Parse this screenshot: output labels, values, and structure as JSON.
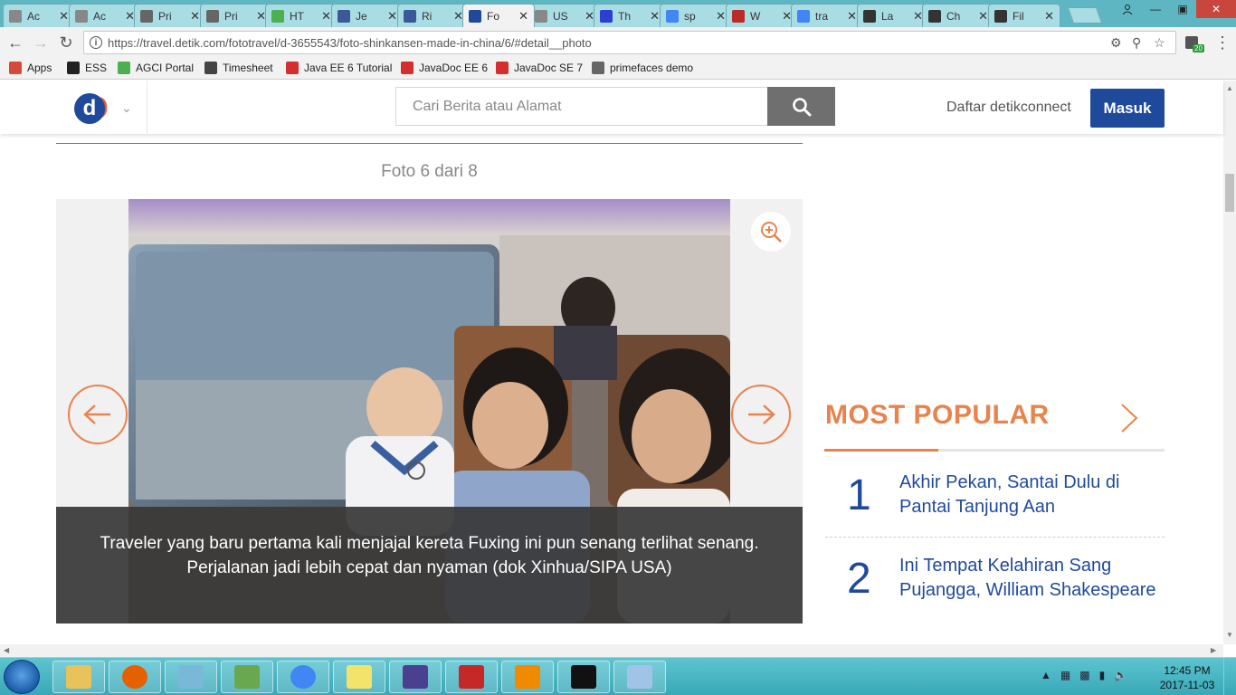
{
  "browser": {
    "tabs": [
      {
        "title": "Ac",
        "icon": "page-icon",
        "color": "#888888"
      },
      {
        "title": "Ac",
        "icon": "page-icon",
        "color": "#888888"
      },
      {
        "title": "Pri",
        "icon": "shield-icon",
        "color": "#666666"
      },
      {
        "title": "Pri",
        "icon": "shield-icon",
        "color": "#666666"
      },
      {
        "title": "HT",
        "icon": "html-icon",
        "color": "#4caf50"
      },
      {
        "title": "Je",
        "icon": "facebook-icon",
        "color": "#3b5998"
      },
      {
        "title": "Ri",
        "icon": "facebook-icon",
        "color": "#3b5998"
      },
      {
        "title": "Fo",
        "icon": "detik-icon",
        "color": "#1f4a9c"
      },
      {
        "title": "US",
        "icon": "page-icon",
        "color": "#888888"
      },
      {
        "title": "Th",
        "icon": "b-icon",
        "color": "#2b3fd1"
      },
      {
        "title": "sp",
        "icon": "google-icon",
        "color": "#4285f4"
      },
      {
        "title": "W",
        "icon": "quora-icon",
        "color": "#b92b27"
      },
      {
        "title": "tra",
        "icon": "google-icon",
        "color": "#4285f4"
      },
      {
        "title": "La",
        "icon": "wikipedia-icon",
        "color": "#333333"
      },
      {
        "title": "Ch",
        "icon": "wikipedia-icon",
        "color": "#333333"
      },
      {
        "title": "Fil",
        "icon": "wikipedia-icon",
        "color": "#333333"
      }
    ],
    "active_tab_index": 7,
    "url": "https://travel.detik.com/fototravel/d-3655543/foto-shinkansen-made-in-china/6/#detail__photo",
    "extension_badge": "20",
    "bookmarks": [
      {
        "label": "Apps",
        "icon": "apps-grid-icon",
        "color": "#d64a3b"
      },
      {
        "label": "ESS",
        "icon": "ess-icon",
        "color": "#222222"
      },
      {
        "label": "AGCI Portal",
        "icon": "agci-icon",
        "color": "#4caf50"
      },
      {
        "label": "Timesheet",
        "icon": "timesheet-icon",
        "color": "#444444"
      },
      {
        "label": "Java EE 6 Tutorial",
        "icon": "oracle-icon",
        "color": "#d32f2f"
      },
      {
        "label": "JavaDoc EE 6",
        "icon": "oracle-icon",
        "color": "#d32f2f"
      },
      {
        "label": "JavaDoc SE 7",
        "icon": "oracle-icon",
        "color": "#d32f2f"
      },
      {
        "label": "primefaces demo",
        "icon": "shield-icon",
        "color": "#666666"
      }
    ]
  },
  "site": {
    "logo_letter": "d",
    "search_placeholder": "Cari Berita atau Alamat",
    "register_label": "Daftar detikconnect",
    "login_label": "Masuk",
    "accent": "#e8834d",
    "brand": "#1f4a9c"
  },
  "gallery": {
    "counter": "Foto 6 dari 8",
    "caption_line1": "Traveler yang baru pertama kali menjajal kereta Fuxing ini pun senang terlihat senang.",
    "caption_line2": "Perjalanan jadi lebih cepat dan nyaman (dok Xinhua/SIPA USA)"
  },
  "most_popular": {
    "title": "MOST POPULAR",
    "items": [
      {
        "rank": "1",
        "title": "Akhir Pekan, Santai Dulu di Pantai Tanjung Aan"
      },
      {
        "rank": "2",
        "title": "Ini Tempat Kelahiran Sang Pujangga, William Shakespeare"
      }
    ]
  },
  "taskbar": {
    "apps": [
      {
        "icon": "file-explorer-icon",
        "color": "#e8c25a"
      },
      {
        "icon": "firefox-icon",
        "color": "#e66000"
      },
      {
        "icon": "notepad-icon",
        "color": "#7ab8d8"
      },
      {
        "icon": "task-manager-icon",
        "color": "#6aa84f"
      },
      {
        "icon": "chrome-icon",
        "color": "#4285f4"
      },
      {
        "icon": "sticky-notes-icon",
        "color": "#f4e36a"
      },
      {
        "icon": "java-ee-ide-icon",
        "color": "#4b3f8f"
      },
      {
        "icon": "acrobat-icon",
        "color": "#c62828"
      },
      {
        "icon": "vlc-icon",
        "color": "#f08a00"
      },
      {
        "icon": "command-prompt-icon",
        "color": "#111111"
      },
      {
        "icon": "paint-icon",
        "color": "#a0c4e8"
      }
    ],
    "time": "12:45 PM",
    "date": "2017-11-03"
  }
}
